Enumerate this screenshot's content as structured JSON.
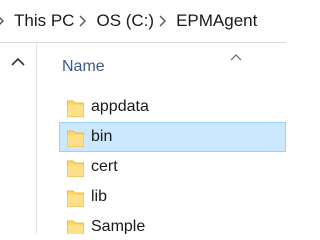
{
  "breadcrumb": {
    "items": [
      "This PC",
      "OS (C:)",
      "EPMAgent"
    ]
  },
  "columns": {
    "name_label": "Name"
  },
  "files": [
    {
      "name": "appdata",
      "type": "folder"
    },
    {
      "name": "bin",
      "type": "folder",
      "selected": true
    },
    {
      "name": "cert",
      "type": "folder"
    },
    {
      "name": "lib",
      "type": "folder"
    },
    {
      "name": "Sample",
      "type": "folder"
    }
  ],
  "icons": {
    "separator": "chevron-right-icon",
    "folder": "folder-icon",
    "scroll_up": "chevron-up-icon",
    "sort": "sort-ascending-icon"
  },
  "colors": {
    "selection_bg": "#cce8ff",
    "selection_border": "#99d1ff",
    "folder_yellow": "#ffd766",
    "header_text": "#3c5a8a"
  }
}
